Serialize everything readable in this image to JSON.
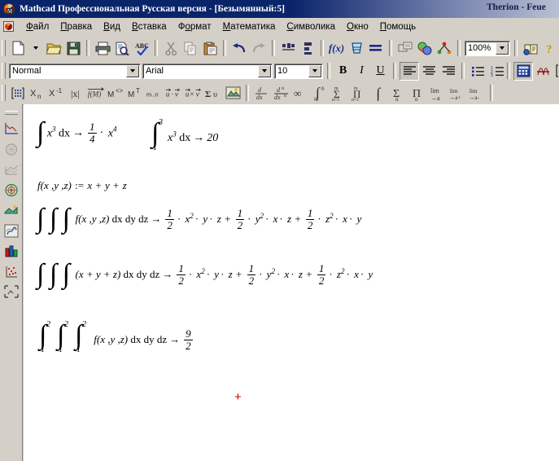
{
  "window": {
    "title": "Mathcad Профессиональная Русская версия - [Безымянный:5]",
    "right_caption": "Therion - Feue",
    "app_icon": "mathcad-logo-icon"
  },
  "menu": {
    "doc_icon": "document-control-icon",
    "items": [
      {
        "label": "Файл",
        "accel": "Ф"
      },
      {
        "label": "Правка",
        "accel": "П"
      },
      {
        "label": "Вид",
        "accel": "В"
      },
      {
        "label": "Вставка",
        "accel": "В"
      },
      {
        "label": "Формат",
        "accel": "о"
      },
      {
        "label": "Математика",
        "accel": "М"
      },
      {
        "label": "Символика",
        "accel": "С"
      },
      {
        "label": "Окно",
        "accel": "О"
      },
      {
        "label": "Помощь",
        "accel": "П"
      }
    ]
  },
  "toolbar_standard": {
    "buttons": [
      {
        "name": "new-document-icon",
        "tip": "Создать"
      },
      {
        "name": "new-dropdown-icon",
        "tip": "Создать (список)"
      },
      {
        "name": "open-folder-icon",
        "tip": "Открыть"
      },
      {
        "name": "save-floppy-icon",
        "tip": "Сохранить"
      },
      {
        "name": "print-icon",
        "tip": "Печать"
      },
      {
        "name": "print-preview-icon",
        "tip": "Предварительный просмотр"
      },
      {
        "name": "spellcheck-icon",
        "tip": "Проверка орфографии"
      },
      {
        "name": "cut-scissors-icon",
        "tip": "Вырезать"
      },
      {
        "name": "copy-icon",
        "tip": "Копировать"
      },
      {
        "name": "paste-clipboard-icon",
        "tip": "Вставить"
      },
      {
        "name": "undo-arrow-icon",
        "tip": "Отменить"
      },
      {
        "name": "redo-arrow-icon",
        "tip": "Вернуть"
      },
      {
        "name": "align-across-icon",
        "tip": "Выровнять по горизонтали"
      },
      {
        "name": "align-down-icon",
        "tip": "Выровнять по вертикали"
      },
      {
        "name": "insert-function-icon",
        "tip": "Вставить функцию"
      },
      {
        "name": "insert-units-icon",
        "tip": "Вставить единицы"
      },
      {
        "name": "calculate-icon",
        "tip": "Вычислить"
      },
      {
        "name": "insert-component-icon",
        "tip": "Вставить компонент"
      },
      {
        "name": "run-component-icon",
        "tip": "Запустить компонент"
      },
      {
        "name": "hyperlink-icon",
        "tip": "Вставить гиперссылку"
      },
      {
        "name": "resource-center-icon",
        "tip": "Центр ресурсов"
      },
      {
        "name": "help-question-icon",
        "tip": "Справка"
      }
    ],
    "zoom_value": "100%"
  },
  "toolbar_format": {
    "style_value": "Normal",
    "style_placeholder": "Normal",
    "font_value": "Arial",
    "font_placeholder": "Arial",
    "size_value": "10",
    "size_placeholder": "10",
    "bold_label": "B",
    "italic_label": "I",
    "underline_label": "U",
    "buttons": [
      {
        "name": "align-left-icon"
      },
      {
        "name": "align-center-icon"
      },
      {
        "name": "align-right-icon"
      },
      {
        "name": "bullet-list-icon"
      },
      {
        "name": "numbered-list-icon"
      },
      {
        "name": "calculator-palette-icon"
      },
      {
        "name": "graph-palette-icon"
      },
      {
        "name": "matrix-palette-icon"
      }
    ],
    "edge_label": "x"
  },
  "toolbar_calculus": {
    "matrix_buttons": [
      {
        "name": "matrix-icon",
        "label": "[:::]"
      },
      {
        "name": "subscript-icon",
        "label": "Xn"
      },
      {
        "name": "inverse-icon",
        "label": "X-1"
      },
      {
        "name": "determinant-icon",
        "label": "|x|"
      },
      {
        "name": "vectorize-icon",
        "label": "f(M)"
      },
      {
        "name": "matrix-column-icon",
        "label": "M<>"
      },
      {
        "name": "transpose-icon",
        "label": "MT"
      },
      {
        "name": "range-variable-icon",
        "label": "m..n"
      },
      {
        "name": "dot-product-icon",
        "label": "u·v"
      },
      {
        "name": "cross-product-icon",
        "label": "u×v"
      },
      {
        "name": "vector-sum-icon",
        "label": "Σu"
      },
      {
        "name": "picture-operator-icon",
        "label": "pic"
      }
    ],
    "calculus_buttons": [
      {
        "name": "derivative-icon",
        "label": "d/dx"
      },
      {
        "name": "nth-derivative-icon",
        "label": "dn/dxn"
      },
      {
        "name": "infinity-icon",
        "label": "∞"
      },
      {
        "name": "definite-integral-icon",
        "label": "∫ab"
      },
      {
        "name": "summation-icon",
        "label": "Σ n=1..m"
      },
      {
        "name": "product-icon",
        "label": "Π n=1..m"
      },
      {
        "name": "indefinite-integral-icon",
        "label": "∫"
      },
      {
        "name": "range-sum-icon",
        "label": "Σn"
      },
      {
        "name": "range-product-icon",
        "label": "Πn"
      },
      {
        "name": "limit-icon",
        "label": "lim →a"
      },
      {
        "name": "limit-right-icon",
        "label": "lim →a+"
      },
      {
        "name": "limit-left-icon",
        "label": "lim →a-"
      }
    ]
  },
  "sidebar": {
    "items": [
      {
        "name": "xy-plot-icon",
        "tip": "X-Y график"
      },
      {
        "name": "polar-plot-icon",
        "tip": "Полярный график"
      },
      {
        "name": "surface-plot-icon",
        "tip": "Поверхность"
      },
      {
        "name": "contour-plot-icon",
        "tip": "Контурный график"
      },
      {
        "name": "3d-scatter-icon",
        "tip": "3D точечный"
      },
      {
        "name": "vector-field-icon",
        "tip": "Векторное поле"
      },
      {
        "name": "bar-chart-icon",
        "tip": "Столбчатая диаграмма"
      },
      {
        "name": "scatter-plot-icon",
        "tip": "Точечный график"
      },
      {
        "name": "zoom-plot-icon",
        "tip": "Масштаб графика"
      }
    ]
  },
  "document": {
    "crosshair_symbol": "+",
    "regions": [
      {
        "id": "indefinite-integral-x3",
        "parts": "∫ x³ dx → (1/4)·x⁴"
      },
      {
        "id": "definite-integral-1-3",
        "parts": "∫₁³ x³ dx → 20"
      },
      {
        "id": "function-definition",
        "parts": "f(x,y,z) := x + y + z"
      },
      {
        "id": "triple-integral-f",
        "parts": "∫∫∫ f(x,y,z) dx dy dz → (1/2)·x²·y·z + (1/2)·y²·x·z + (1/2)·z²·x·y"
      },
      {
        "id": "triple-integral-expr",
        "parts": "∫∫∫ (x + y + z) dx dy dz → (1/2)·x²·y·z + (1/2)·y²·x·z + (1/2)·z²·x·y"
      },
      {
        "id": "definite-triple-integral",
        "parts": "∫₁²∫₁²∫₁² f(x,y,z) dx dy dz → 9/2"
      }
    ],
    "text": {
      "dx": "dx",
      "dy": "dy",
      "dz": "dz",
      "arrow": "→",
      "define": ":=",
      "plus": "+",
      "dot": "·",
      "f_name": "f",
      "args": "(x ,y ,z)",
      "expr_sum": "(x + y + z)",
      "x": "x",
      "y": "y",
      "z": "z",
      "one": "1",
      "two": "2",
      "three": "3",
      "four": "4",
      "nine": "9",
      "twenty": "20"
    }
  }
}
